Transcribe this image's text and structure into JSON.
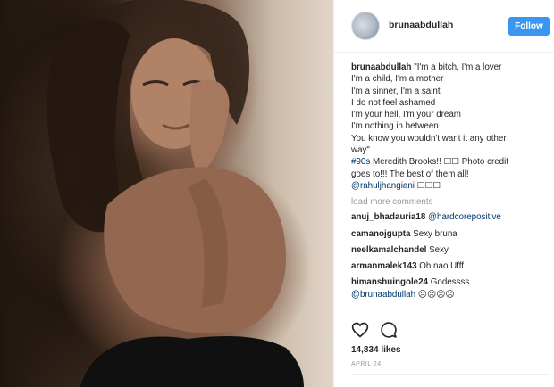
{
  "post": {
    "username": "brunaabdullah",
    "follow_label": "Follow",
    "caption": {
      "username": "brunaabdullah",
      "lines": [
        "\"I'm a bitch, I'm a lover",
        "I'm a child, I'm a mother",
        "I'm a sinner, I'm a saint",
        "I do not feel ashamed",
        "I'm your hell, I'm your dream",
        "I'm nothing in between",
        "You know you wouldn't want it any other",
        "way\""
      ],
      "hashtag": "#90s",
      "after_hashtag": " Meredith Brooks!! ☐☐ Photo credit",
      "line_credit": "goes to!!! The best of them all!",
      "mention": "@rahuljhangiani",
      "mention_suffix": " ☐☐☐"
    },
    "load_more": "load more comments",
    "comments": [
      {
        "user": "anuj_bhadauria18",
        "link": "@hardcorepositive",
        "text": ""
      },
      {
        "user": "camanojgupta",
        "link": "",
        "text": "Sexy bruna"
      },
      {
        "user": "neelkamalchandel",
        "link": "",
        "text": "Sexy"
      },
      {
        "user": "armanmalek143",
        "link": "",
        "text": "Oh nao.Ufff"
      },
      {
        "user": "himanshuingole24",
        "link": "",
        "text": "Godessss"
      }
    ],
    "last_comment_mention": "@brunaabdullah",
    "last_comment_suffix": " ☹☹☹☹",
    "likes": "14,834 likes",
    "date": "APRIL 24",
    "icons": [
      "heart-icon",
      "comment-icon"
    ],
    "colors": {
      "accent": "#3897f0",
      "link": "#003569",
      "muted": "#999999"
    }
  }
}
